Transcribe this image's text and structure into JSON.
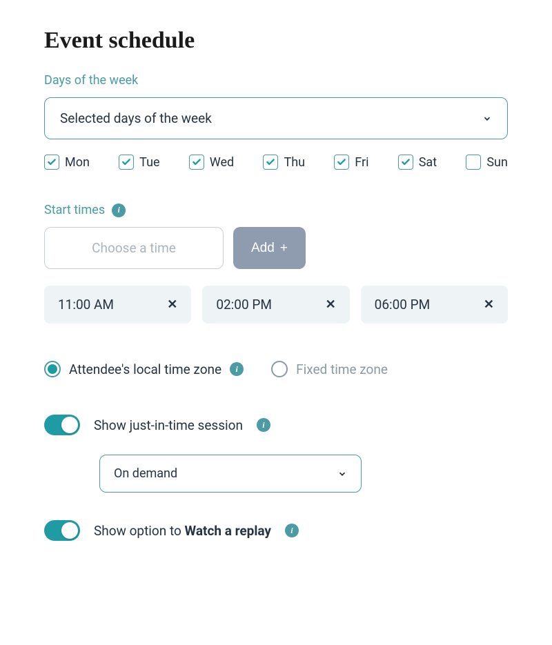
{
  "title": "Event schedule",
  "days_label": "Days of the week",
  "days_select_value": "Selected days of the week",
  "days": [
    {
      "label": "Mon",
      "checked": true
    },
    {
      "label": "Tue",
      "checked": true
    },
    {
      "label": "Wed",
      "checked": true
    },
    {
      "label": "Thu",
      "checked": true
    },
    {
      "label": "Fri",
      "checked": true
    },
    {
      "label": "Sat",
      "checked": true
    },
    {
      "label": "Sun",
      "checked": false
    }
  ],
  "start_times_label": "Start times",
  "time_placeholder": "Choose a time",
  "add_label": "Add",
  "times": [
    "11:00 AM",
    "02:00 PM",
    "06:00 PM"
  ],
  "tz": {
    "local_label": "Attendee's local time zone",
    "fixed_label": "Fixed time zone",
    "selected": "local"
  },
  "jit": {
    "label": "Show just-in-time session",
    "on": true,
    "select_value": "On demand"
  },
  "replay": {
    "prefix": "Show option to ",
    "bold": "Watch a replay",
    "on": true
  }
}
